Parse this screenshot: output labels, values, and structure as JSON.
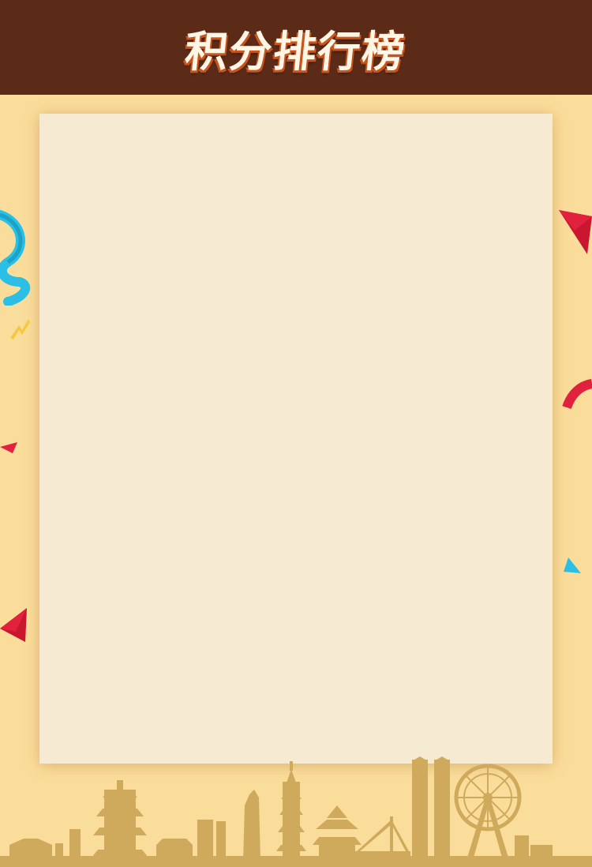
{
  "header": {
    "title": "积分排行榜"
  },
  "colors": {
    "background": "#fbdd9b",
    "header": "#5c2b18",
    "panel": "#f6ead3",
    "skyline": "#d0aa5c",
    "confetti_red": "#e2213f",
    "confetti_blue": "#2bbfe6",
    "confetti_yellow": "#f6c842"
  },
  "decorations": [
    "confetti",
    "city-skyline"
  ]
}
